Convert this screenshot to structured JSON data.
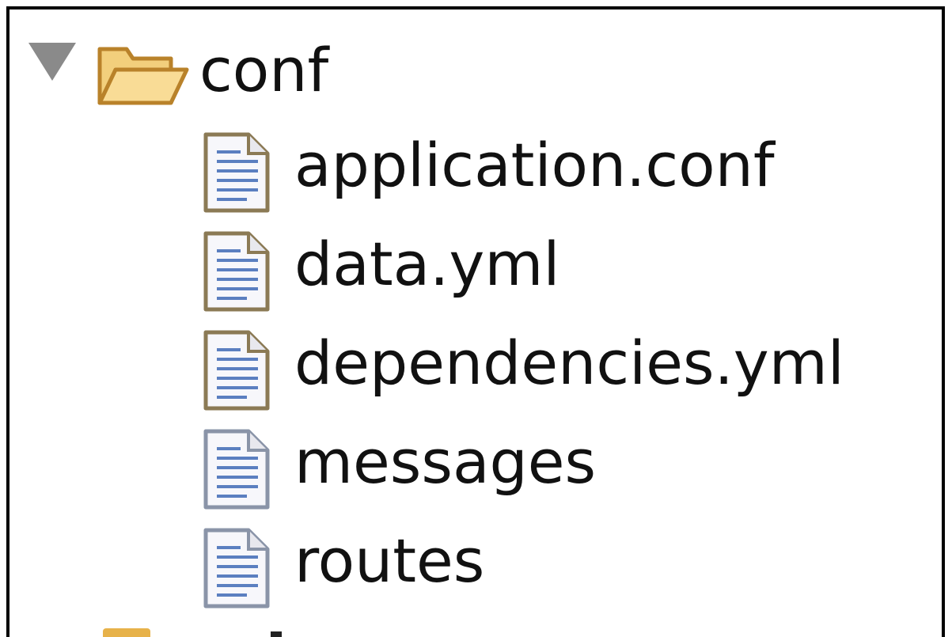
{
  "tree": {
    "folder": {
      "name": "conf",
      "expanded": true,
      "icon": "folder-open-icon"
    },
    "files": [
      {
        "name": "application.conf",
        "icon": "text-file-icon"
      },
      {
        "name": "data.yml",
        "icon": "text-file-icon"
      },
      {
        "name": "dependencies.yml",
        "icon": "text-file-icon"
      },
      {
        "name": "messages",
        "icon": "text-file-icon"
      },
      {
        "name": "routes",
        "icon": "text-file-icon"
      }
    ]
  },
  "colors": {
    "folder_fill": "#f4c96b",
    "folder_stroke": "#b9822a",
    "file_border": "#8b7a55",
    "file_lines": "#5b7fc0",
    "twisty": "#8a8a8a",
    "text": "#111111"
  }
}
